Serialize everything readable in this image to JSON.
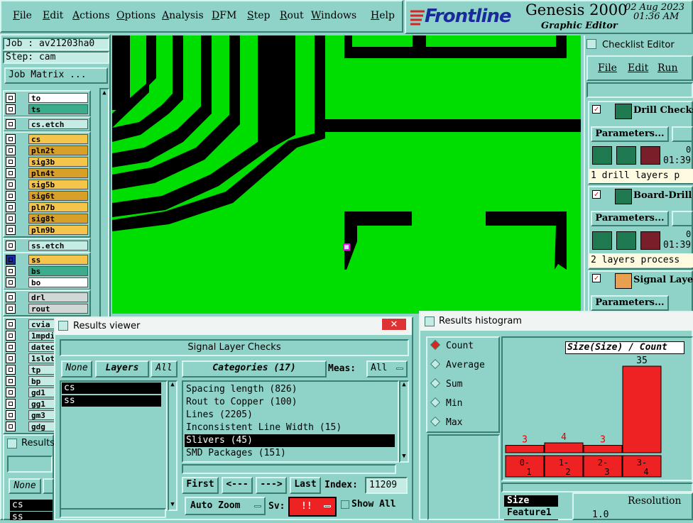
{
  "menubar": {
    "items": [
      "File",
      "Edit",
      "Actions",
      "Options",
      "Analysis",
      "DFM",
      "Step",
      "Rout",
      "Windows",
      "Help"
    ]
  },
  "brand": {
    "logo": "Frontline",
    "product": "Genesis 2000",
    "subtitle": "Graphic Editor",
    "date": "02 Aug 2023",
    "time": "01:36 AM"
  },
  "job": {
    "job_line": "Job : av21203ha0",
    "step_line": "Step: cam",
    "matrix_button": "Job Matrix ..."
  },
  "layers": {
    "group1": [
      "to",
      "ts"
    ],
    "group2": [
      "cs.etch"
    ],
    "group3": [
      "cs",
      "pln2t",
      "sig3b",
      "pln4t",
      "sig5b",
      "sig6t",
      "pln7b",
      "sig8t",
      "pln9b"
    ],
    "group4": [
      "ss.etch"
    ],
    "group5": [
      "ss",
      "bs",
      "bo"
    ],
    "group6": [
      "drl",
      "rout"
    ],
    "group7": [
      "cvia",
      "1mpdi",
      "datec",
      "1slot",
      "tp",
      "bp",
      "gd1",
      "gg1",
      "gm3",
      "gdg"
    ]
  },
  "colors": {
    "copper_green": "#00dd00",
    "background_black": "#000000",
    "panel_teal": "#8fd3c8",
    "signal_yellow": "#f5c44a",
    "histogram_red": "#ee2222"
  },
  "checklist": {
    "title": "Checklist Editor",
    "menu": [
      "File",
      "Edit",
      "Run"
    ],
    "checks": [
      {
        "name": "Drill Checks",
        "params": "Parameters...",
        "time": "01:39",
        "count": "0",
        "status": "1 drill layers p"
      },
      {
        "name": "Board-Drill C",
        "params": "Parameters...",
        "time": "01:39",
        "count": "0",
        "status": "2 layers process"
      },
      {
        "name": "Signal Layer",
        "params": "Parameters..."
      }
    ]
  },
  "results_viewer": {
    "title": "Results viewer",
    "heading": "Signal Layer Checks",
    "none_btn": "None",
    "layers_btn": "Layers",
    "all_btn": "All",
    "categories_btn": "Categories (17)",
    "meas_label": "Meas:",
    "meas_value": "All",
    "layer_list": [
      "cs",
      "ss"
    ],
    "categories": [
      "Spacing length (826)",
      "Rout to Copper (100)",
      "Lines (2205)",
      "Inconsistent Line Width (15)",
      "Slivers (45)",
      "SMD Packages (151)"
    ],
    "selected_category": "Slivers (45)",
    "first_btn": "First",
    "prev_btn": "<---",
    "next_btn": "--->",
    "last_btn": "Last",
    "index_label": "Index:",
    "index_value": "11209",
    "zoom_btn": "Auto Zoom",
    "sv_label": "Sv:",
    "sv_value": "!!",
    "show_all": "Show All"
  },
  "results_small": {
    "title": "Results",
    "none_btn": "None",
    "layers": [
      "cs",
      "ss"
    ]
  },
  "histogram": {
    "title": "Results histogram",
    "modes": [
      "Count",
      "Average",
      "Sum",
      "Min",
      "Max"
    ],
    "selected_mode": "Count",
    "chart_title": "Size(Size) / Count",
    "bottom_label1": "Size",
    "bottom_label2": "Feature1",
    "resolution_label": "Resolution",
    "resolution_value": "1.0"
  },
  "chart_data": {
    "type": "bar",
    "title": "Size(Size) / Count",
    "categories": [
      "0-1",
      "1-2",
      "2-3",
      "3-4"
    ],
    "values": [
      3,
      4,
      3,
      35
    ],
    "ylim": [
      0,
      35
    ]
  }
}
